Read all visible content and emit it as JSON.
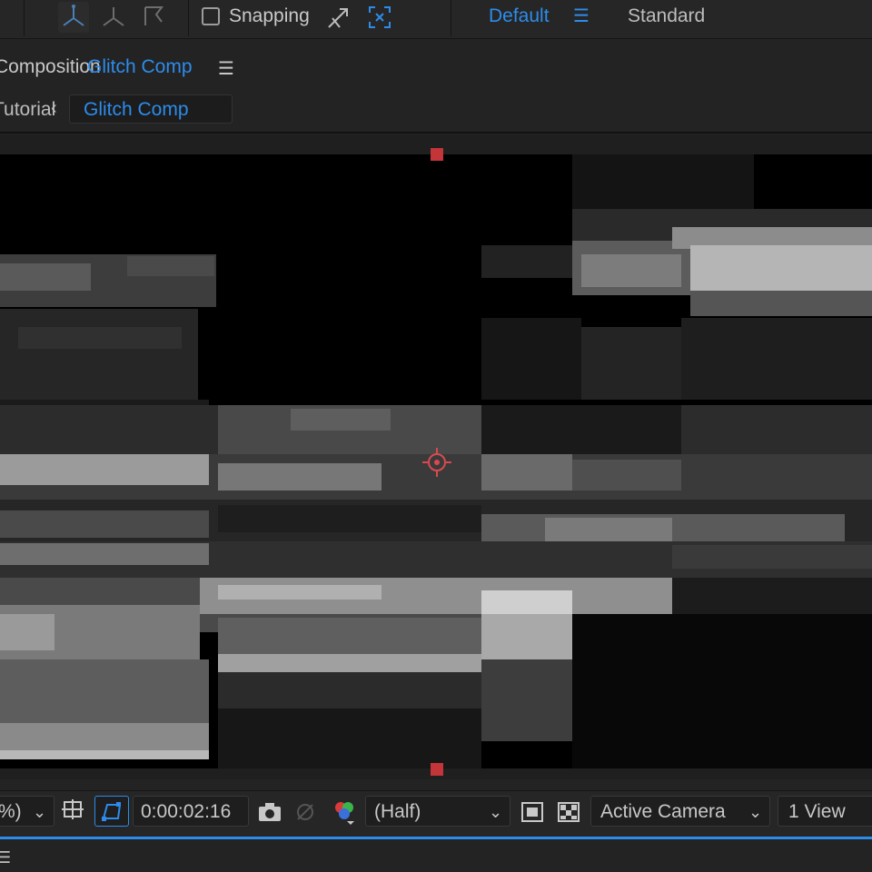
{
  "toolbar": {
    "snapping_label": "Snapping",
    "snapping_checked": false,
    "workspace_active": "Default",
    "workspace_other": "Standard",
    "icons": [
      "axis-local-icon",
      "axis-world-icon",
      "axis-view-icon",
      "snap-arrows-icon",
      "snap-target-icon",
      "workspace-menu-icon"
    ]
  },
  "panel": {
    "title_prefix": "Composition",
    "comp_name": "Glitch Comp",
    "breadcrumb_previous": "Tutorial",
    "breadcrumb_current": "Glitch Comp"
  },
  "viewer": {
    "handle_color": "#c4353a",
    "anchor_point_color": "#d84a50"
  },
  "bottom_bar": {
    "zoom": "%)",
    "current_time": "0:00:02:16",
    "resolution": "(Half)",
    "camera": "Active Camera",
    "views": "1 View",
    "accent_color": "#2d8ceb"
  }
}
